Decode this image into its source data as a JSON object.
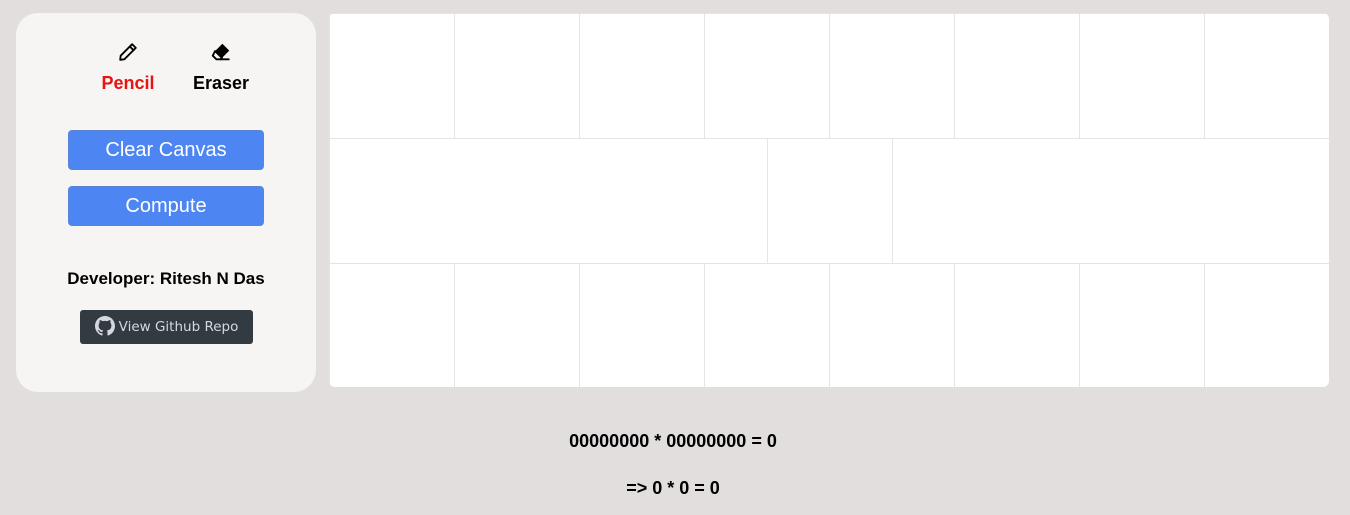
{
  "tools": {
    "pencil": {
      "icon": "pencil-icon",
      "label": "Pencil",
      "active": true,
      "color": "#e7140f"
    },
    "eraser": {
      "icon": "eraser-icon",
      "label": "Eraser",
      "active": false
    }
  },
  "actions": {
    "clear_label": "Clear Canvas",
    "compute_label": "Compute"
  },
  "footer": {
    "developer_text": "Developer: Ritesh N Das",
    "github_label": "View Github Repo",
    "github_icon": "github-icon"
  },
  "canvas": {
    "rows": [
      {
        "cells": 8
      },
      {
        "cells": 3
      },
      {
        "cells": 8
      }
    ]
  },
  "result": {
    "expression": "00000000 * 00000000 = 0",
    "simplified": "=> 0 * 0 = 0"
  },
  "colors": {
    "background": "#e1dedd",
    "panel": "#f6f5f3",
    "primary_button": "#4d86f2",
    "github_button": "#323a42",
    "active_tool": "#e7140f"
  }
}
